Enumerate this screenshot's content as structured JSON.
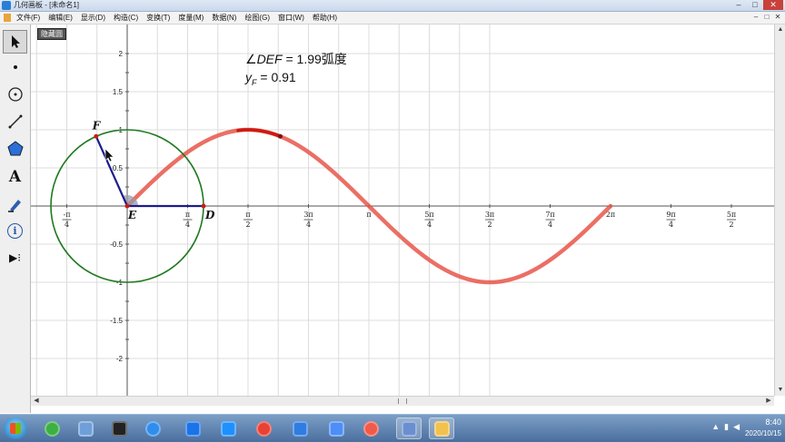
{
  "window": {
    "title": "几何画板 - [未命名1]",
    "controls": [
      "–",
      "□",
      "✕"
    ]
  },
  "menu": {
    "items": [
      "文件(F)",
      "编辑(E)",
      "显示(D)",
      "构造(C)",
      "变换(T)",
      "度量(M)",
      "数据(N)",
      "绘图(G)",
      "窗口(W)",
      "帮助(H)"
    ],
    "mdi_controls": [
      "–",
      "□",
      "✕"
    ]
  },
  "toolbox": {
    "tools": [
      {
        "name": "arrow-select-tool",
        "icon": "arrow-icon",
        "active": true
      },
      {
        "name": "point-tool",
        "icon": "point-icon"
      },
      {
        "name": "compass-tool",
        "icon": "compass-icon"
      },
      {
        "name": "straightedge-tool",
        "icon": "segment-icon"
      },
      {
        "name": "polygon-tool",
        "icon": "polygon-icon"
      },
      {
        "name": "text-tool",
        "icon": "text-icon",
        "glyph": "A"
      },
      {
        "name": "marker-tool",
        "icon": "marker-icon"
      },
      {
        "name": "information-tool",
        "icon": "info-icon",
        "glyph": "i"
      },
      {
        "name": "custom-tool",
        "icon": "custom-tool-icon",
        "glyph": "▶⁝"
      }
    ]
  },
  "sketch": {
    "hide_button": "隐藏圆",
    "measurement_angle": {
      "prefix": "∠",
      "name": "DEF",
      "eq": " = ",
      "value": "1.99",
      "unit": "弧度"
    },
    "measurement_y": {
      "var": "y",
      "sub": "F",
      "eq": " = ",
      "value": "0.91"
    },
    "point_labels": {
      "F": "F",
      "E": "E",
      "D": "D"
    },
    "y_ticks": [
      {
        "value": 2,
        "label": "2"
      },
      {
        "value": 1.5,
        "label": "1.5"
      },
      {
        "value": 1,
        "label": "1"
      },
      {
        "value": 0.5,
        "label": "0.5"
      },
      {
        "value": -0.5,
        "label": "-0.5"
      },
      {
        "value": -1,
        "label": "-1"
      },
      {
        "value": -1.5,
        "label": "-1.5"
      },
      {
        "value": -2,
        "label": "-2"
      }
    ],
    "x_ticks": [
      {
        "k": -1,
        "num": "-π",
        "den": "4"
      },
      {
        "k": 1,
        "num": "π",
        "den": "4"
      },
      {
        "k": 2,
        "num": "π",
        "den": "2"
      },
      {
        "k": 3,
        "num": "3π",
        "den": "4"
      },
      {
        "k": 4,
        "num": "π",
        "den": ""
      },
      {
        "k": 5,
        "num": "5π",
        "den": "4"
      },
      {
        "k": 6,
        "num": "3π",
        "den": "2"
      },
      {
        "k": 7,
        "num": "7π",
        "den": "4"
      },
      {
        "k": 8,
        "num": "2π",
        "den": ""
      },
      {
        "k": 9,
        "num": "9π",
        "den": "4"
      },
      {
        "k": 10,
        "num": "5π",
        "den": "2"
      }
    ],
    "colors": {
      "grid": "#dcdcdc",
      "axis": "#555555",
      "circle": "#1f7a1f",
      "segment": "#1c1c8c",
      "sine_trace": "#e8564a",
      "sine_dark": "#cc1a12",
      "angle_mark": "#9a9aa8"
    }
  },
  "scrollbars": {
    "up": "▲",
    "down": "▼",
    "left": "◀",
    "right": "▶"
  },
  "taskbar": {
    "icons": [
      {
        "name": "360-browser-icon",
        "color": "#3cb043"
      },
      {
        "name": "document-app-icon",
        "color": "#6f9fd8"
      },
      {
        "name": "qq-penguin-icon",
        "color": "#222222"
      },
      {
        "name": "baidu-netdisk-icon",
        "color": "#2f8ded"
      },
      {
        "name": "media-player-icon",
        "color": "#1a73e8"
      },
      {
        "name": "kugou-music-icon",
        "color": "#1e90ff"
      },
      {
        "name": "chrome-icon",
        "color": "#e94235"
      },
      {
        "name": "security-shield-icon",
        "color": "#2f7de1"
      },
      {
        "name": "feishu-bird-icon",
        "color": "#4d8ef7"
      },
      {
        "name": "screen-recorder-icon",
        "color": "#f05a4a"
      },
      {
        "name": "geometers-sketchpad-icon",
        "color": "#6a8fd1"
      },
      {
        "name": "file-explorer-icon",
        "color": "#f2c14e"
      }
    ],
    "clock": {
      "time": "8:40",
      "date": "2020/10/15"
    }
  }
}
